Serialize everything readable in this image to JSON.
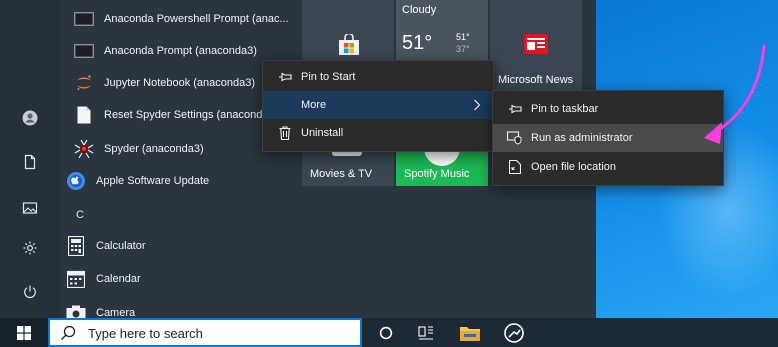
{
  "start_menu": {
    "apps": [
      {
        "label": "Anaconda Powershell Prompt (anac...",
        "icon": "terminal-icon"
      },
      {
        "label": "Anaconda Prompt (anaconda3)",
        "icon": "terminal-icon"
      },
      {
        "label": "Jupyter Notebook (anaconda3)",
        "icon": "jupyter-icon"
      },
      {
        "label": "Reset Spyder Settings (anaconda3",
        "icon": "document-icon"
      },
      {
        "label": "Spyder (anaconda3)",
        "icon": "spyder-icon"
      },
      {
        "label": "Apple Software Update",
        "icon": "apple-update-icon"
      },
      {
        "label": "Calculator",
        "icon": "calculator-icon"
      },
      {
        "label": "Calendar",
        "icon": "calendar-icon"
      },
      {
        "label": "Camera",
        "icon": "camera-icon"
      }
    ],
    "section_letter": "C"
  },
  "tiles": {
    "weather": {
      "condition": "Cloudy",
      "temp": "51°",
      "high": "51°",
      "low": "37°"
    },
    "news_label": "Microsoft News",
    "movies_label": "Movies & TV",
    "spotify_label": "Spotify Music",
    "colors": {
      "spotify": "#1db954",
      "news": "#e81123",
      "store": "#3a4651"
    }
  },
  "context_menu": {
    "items": [
      {
        "label": "Pin to Start",
        "icon": "pin-icon"
      },
      {
        "label": "More",
        "icon": ""
      },
      {
        "label": "Uninstall",
        "icon": "trash-icon"
      }
    ]
  },
  "submenu": {
    "items": [
      {
        "label": "Pin to taskbar",
        "icon": "pin-icon"
      },
      {
        "label": "Run as administrator",
        "icon": "admin-shield-icon"
      },
      {
        "label": "Open file location",
        "icon": "file-location-icon"
      }
    ]
  },
  "annotation": {
    "arrow_color": "#ff3dde"
  },
  "taskbar": {
    "search_placeholder": "Type here to search",
    "accent": "#0a78d4"
  }
}
